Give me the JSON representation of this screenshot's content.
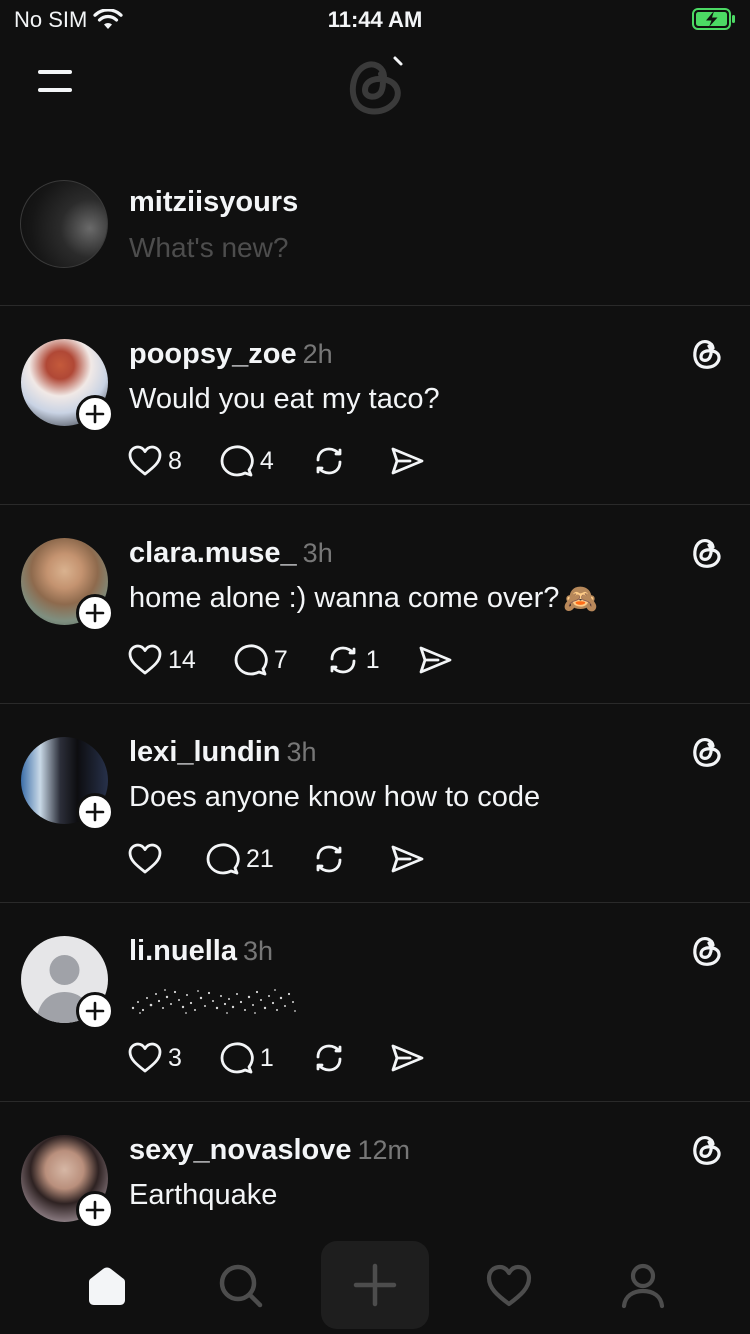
{
  "status_bar": {
    "carrier": "No SIM",
    "time": "11:44 AM"
  },
  "composer": {
    "username": "mitziisyours",
    "placeholder": "What's new?"
  },
  "posts": [
    {
      "username": "poopsy_zoe",
      "time": "2h",
      "text": "Would you eat my taco?",
      "likes": "8",
      "replies": "4",
      "reposts": ""
    },
    {
      "username": "clara.muse_",
      "time": "3h",
      "text": "home alone :) wanna come over?",
      "emoji": "🙈",
      "likes": "14",
      "replies": "7",
      "reposts": "1"
    },
    {
      "username": "lexi_lundin",
      "time": "3h",
      "text": "Does anyone know how to code",
      "likes": "",
      "replies": "21",
      "reposts": ""
    },
    {
      "username": "li.nuella",
      "time": "3h",
      "text": "",
      "likes": "3",
      "replies": "1",
      "reposts": ""
    },
    {
      "username": "sexy_novaslove",
      "time": "12m",
      "text": "Earthquake",
      "likes": "",
      "replies": "",
      "reposts": ""
    }
  ],
  "icons": {
    "menu": "hamburger-icon",
    "logo": "threads-logo",
    "post_badge": "threads-icon",
    "like": "heart-icon",
    "reply": "comment-icon",
    "repost": "repost-icon",
    "share": "send-icon",
    "tabs": [
      "home-icon",
      "search-icon",
      "plus-icon",
      "heart-icon",
      "profile-icon"
    ]
  },
  "colors": {
    "background": "#101010",
    "text": "#f3f5f7",
    "muted": "#777777",
    "placeholder": "#4d4d4d",
    "battery": "#4cd964"
  }
}
